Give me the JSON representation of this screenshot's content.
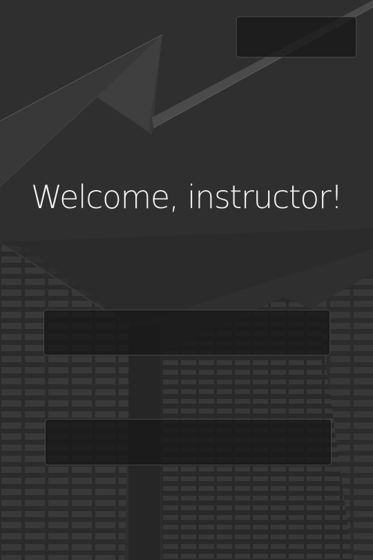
{
  "screen": {
    "welcome_title": "Welcome, instructor!",
    "top_right_button": {
      "label": ""
    },
    "primary_field": {
      "value": "",
      "placeholder": ""
    },
    "secondary_field": {
      "value": "",
      "placeholder": ""
    }
  },
  "colors": {
    "background": "#2f2f2f",
    "panel": "#181818",
    "panel_border": "#4a4a4a",
    "text": "#f2f2f2"
  },
  "icons": {
    "background_image": "building-facade-image"
  }
}
